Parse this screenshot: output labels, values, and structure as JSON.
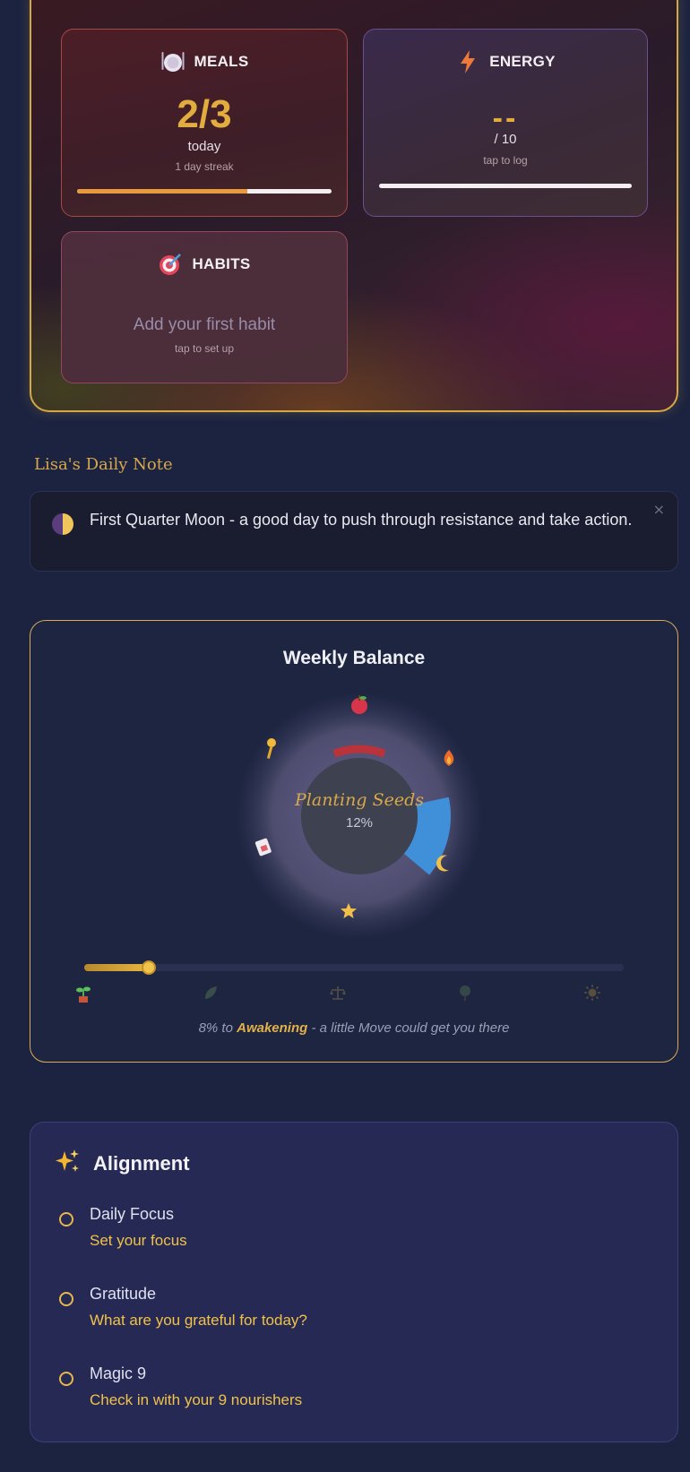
{
  "tiles": {
    "meals": {
      "title": "MEALS",
      "icon": "plate-icon",
      "value": "2/3",
      "period": "today",
      "streak": "1 day streak",
      "progress": 0.67
    },
    "energy": {
      "title": "ENERGY",
      "icon": "lightning-icon",
      "value": "--",
      "scale": "/ 10",
      "hint": "tap to log",
      "progress": 0
    },
    "habits": {
      "title": "HABITS",
      "icon": "target-icon",
      "empty_text": "Add your first habit",
      "hint": "tap to set up"
    }
  },
  "daily_note": {
    "title": "Lisa's Daily Note",
    "icon": "moon-phase-icon",
    "text": "First Quarter Moon - a good day to push through resistance and take action.",
    "close_label": "×"
  },
  "weekly_balance": {
    "title": "Weekly Balance",
    "stage_name": "Planting Seeds",
    "percent_label": "12%",
    "percent": 12,
    "progress": 0.12,
    "segment_icons": [
      "apple-icon",
      "fire-icon",
      "moon-icon",
      "star-icon",
      "journal-icon",
      "key-icon"
    ],
    "stages": [
      "sprout-icon",
      "leaf-icon",
      "scales-icon",
      "tree-icon",
      "sun-icon"
    ],
    "footer_pre": "8% to ",
    "footer_stage": "Awakening",
    "footer_post": " - a little Move could get you there"
  },
  "alignment": {
    "title": "Alignment",
    "icon": "sparkles-icon",
    "items": [
      {
        "label": "Daily Focus",
        "prompt": "Set your focus"
      },
      {
        "label": "Gratitude",
        "prompt": "What are you grateful for today?"
      },
      {
        "label": "Magic 9",
        "prompt": "Check in with your 9 nourishers"
      }
    ]
  },
  "colors": {
    "accent_gold": "#e3ac3e",
    "bg": "#1b2340",
    "segment_blue": "#3f8fd9",
    "segment_red": "#b8343a"
  }
}
